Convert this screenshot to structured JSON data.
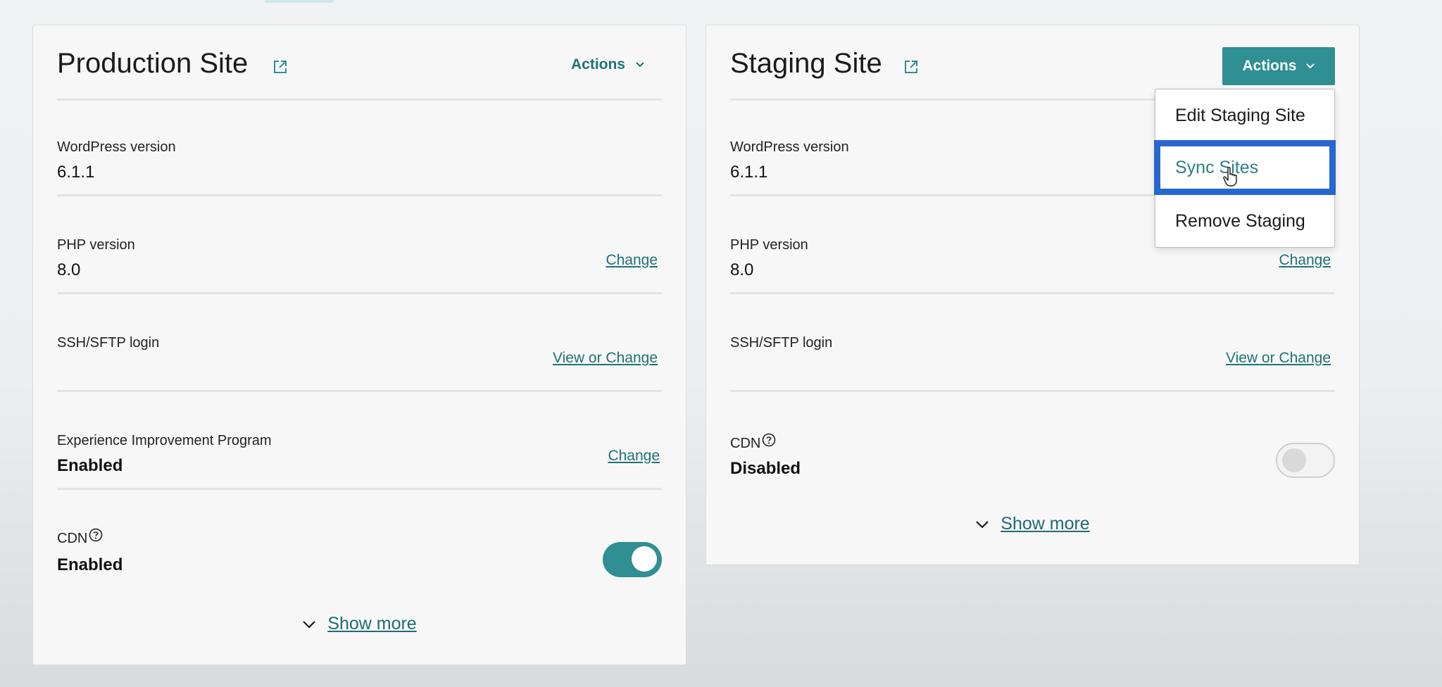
{
  "production": {
    "title": "Production Site",
    "actions_label": "Actions",
    "rows": {
      "wordpress": {
        "label": "WordPress version",
        "value": "6.1.1"
      },
      "php": {
        "label": "PHP version",
        "value": "8.0",
        "link": "Change"
      },
      "ssh": {
        "label": "SSH/SFTP login",
        "link": "View or Change"
      },
      "experience": {
        "label": "Experience Improvement Program",
        "value": "Enabled",
        "link": "Change"
      },
      "cdn": {
        "label": "CDN",
        "value": "Enabled",
        "toggle_state": "on"
      }
    },
    "show_more": "Show more"
  },
  "staging": {
    "title": "Staging Site",
    "actions_label": "Actions",
    "rows": {
      "wordpress": {
        "label": "WordPress version",
        "value": "6.1.1"
      },
      "php": {
        "label": "PHP version",
        "value": "8.0",
        "link": "Change"
      },
      "ssh": {
        "label": "SSH/SFTP login",
        "link": "View or Change"
      },
      "cdn": {
        "label": "CDN",
        "value": "Disabled",
        "toggle_state": "off"
      }
    },
    "show_more": "Show more"
  },
  "actions_menu": {
    "items": [
      {
        "label": "Edit Staging Site"
      },
      {
        "label": "Sync Sites",
        "selected": true
      },
      {
        "label": "Remove Staging"
      }
    ]
  },
  "icons": {
    "external_link": "external-link-icon",
    "chevron": "chevron-down-icon",
    "help": "help-circle-icon",
    "cursor": "hand-pointer-icon"
  },
  "colors": {
    "accent": "#2f8f93",
    "link": "#1e7276",
    "selection_border": "#2766d0"
  }
}
